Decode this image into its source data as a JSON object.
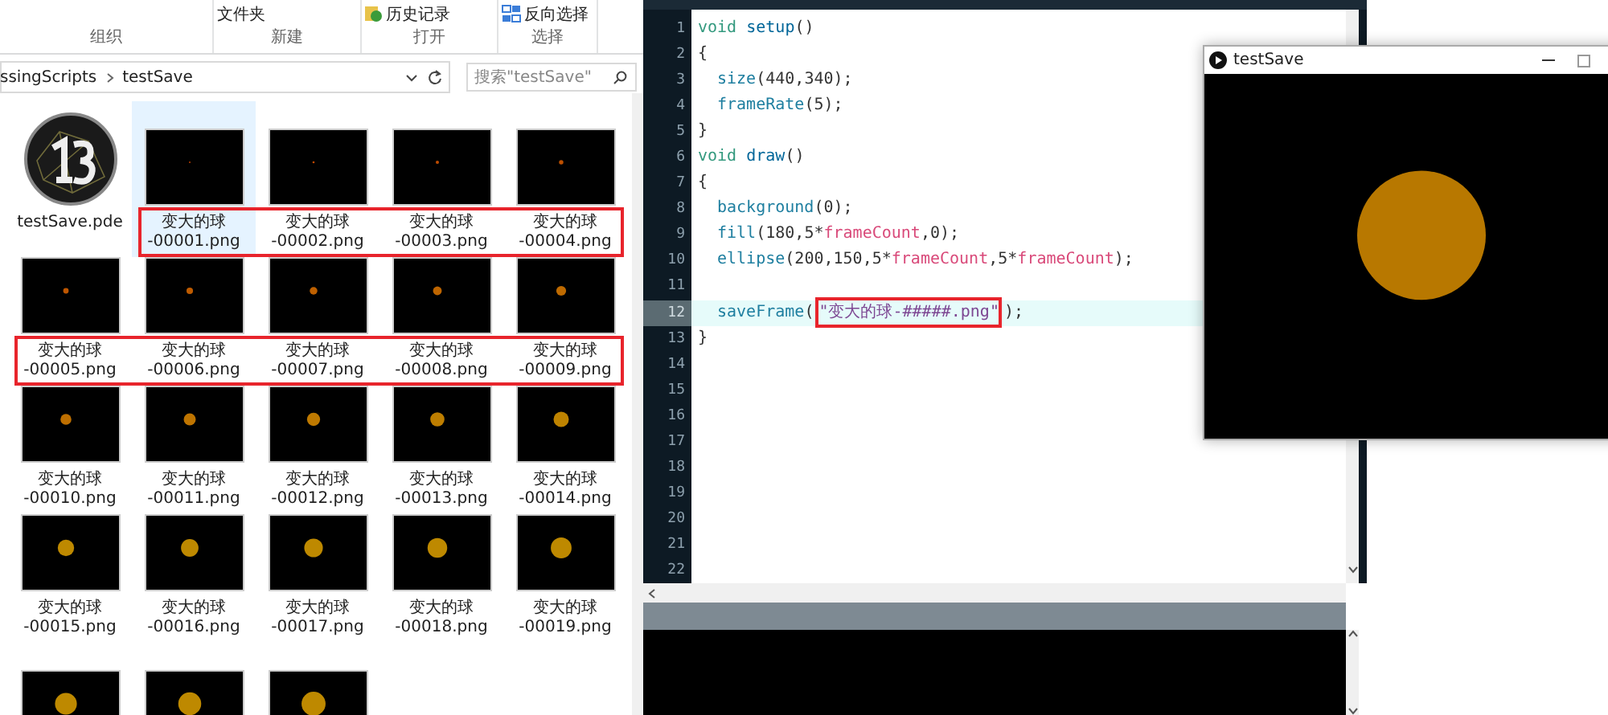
{
  "ribbon": {
    "groups": [
      {
        "label": "组织"
      },
      {
        "label": "新建",
        "items": [
          {
            "kind": "plain",
            "label": "文件夹"
          }
        ]
      },
      {
        "label": "打开",
        "items": [
          {
            "kind": "history",
            "label": "历史记录"
          }
        ]
      },
      {
        "label": "选择",
        "items": [
          {
            "kind": "select",
            "label": "反向选择"
          }
        ]
      }
    ]
  },
  "address_bar": {
    "path": [
      "ssingScripts",
      "testSave"
    ]
  },
  "search": {
    "placeholder": "搜索\"testSave\""
  },
  "files": {
    "rows": [
      {
        "items": [
          {
            "kind": "pde",
            "name_lines": [
              "testSave.pde"
            ],
            "selected": false,
            "marked": false
          },
          {
            "kind": "png",
            "name_lines": [
              "变大的球",
              "-00001.png"
            ],
            "selected": true,
            "marked": true
          },
          {
            "kind": "png",
            "name_lines": [
              "变大的球",
              "-00002.png"
            ],
            "selected": false,
            "marked": true
          },
          {
            "kind": "png",
            "name_lines": [
              "变大的球",
              "-00003.png"
            ],
            "selected": false,
            "marked": true
          },
          {
            "kind": "png",
            "name_lines": [
              "变大的球",
              "-00004.png"
            ],
            "selected": false,
            "marked": true
          }
        ]
      },
      {
        "items": [
          {
            "kind": "png",
            "name_lines": [
              "变大的球",
              "-00005.png"
            ],
            "selected": false,
            "marked": true
          },
          {
            "kind": "png",
            "name_lines": [
              "变大的球",
              "-00006.png"
            ],
            "selected": false,
            "marked": true
          },
          {
            "kind": "png",
            "name_lines": [
              "变大的球",
              "-00007.png"
            ],
            "selected": false,
            "marked": true
          },
          {
            "kind": "png",
            "name_lines": [
              "变大的球",
              "-00008.png"
            ],
            "selected": false,
            "marked": true
          },
          {
            "kind": "png",
            "name_lines": [
              "变大的球",
              "-00009.png"
            ],
            "selected": false,
            "marked": true
          }
        ]
      },
      {
        "items": [
          {
            "kind": "png",
            "name_lines": [
              "变大的球",
              "-00010.png"
            ],
            "selected": false,
            "marked": false
          },
          {
            "kind": "png",
            "name_lines": [
              "变大的球",
              "-00011.png"
            ],
            "selected": false,
            "marked": false
          },
          {
            "kind": "png",
            "name_lines": [
              "变大的球",
              "-00012.png"
            ],
            "selected": false,
            "marked": false
          },
          {
            "kind": "png",
            "name_lines": [
              "变大的球",
              "-00013.png"
            ],
            "selected": false,
            "marked": false
          },
          {
            "kind": "png",
            "name_lines": [
              "变大的球",
              "-00014.png"
            ],
            "selected": false,
            "marked": false
          }
        ]
      },
      {
        "items": [
          {
            "kind": "png",
            "name_lines": [
              "变大的球",
              "-00015.png"
            ],
            "selected": false,
            "marked": false
          },
          {
            "kind": "png",
            "name_lines": [
              "变大的球",
              "-00016.png"
            ],
            "selected": false,
            "marked": false
          },
          {
            "kind": "png",
            "name_lines": [
              "变大的球",
              "-00017.png"
            ],
            "selected": false,
            "marked": false
          },
          {
            "kind": "png",
            "name_lines": [
              "变大的球",
              "-00018.png"
            ],
            "selected": false,
            "marked": false
          },
          {
            "kind": "png",
            "name_lines": [
              "变大的球",
              "-00019.png"
            ],
            "selected": false,
            "marked": false
          }
        ]
      },
      {
        "items": [
          {
            "kind": "png",
            "selected": false,
            "marked": false
          },
          {
            "kind": "png",
            "selected": false,
            "marked": false
          },
          {
            "kind": "png",
            "selected": false,
            "marked": false
          }
        ]
      }
    ]
  },
  "editor": {
    "lines": [
      {
        "number": "1",
        "highlighted": false,
        "indented": false,
        "tokens": [
          {
            "kind": "keyword",
            "text": "void "
          },
          {
            "kind": "function",
            "text": "setup"
          },
          {
            "kind": "plain",
            "text": "()"
          }
        ]
      },
      {
        "number": "2",
        "highlighted": false,
        "indented": false,
        "tokens": [
          {
            "kind": "plain",
            "text": "{"
          }
        ]
      },
      {
        "number": "3",
        "highlighted": false,
        "indented": true,
        "tokens": [
          {
            "kind": "builtin",
            "text": "size"
          },
          {
            "kind": "plain",
            "text": "(440,340);"
          }
        ]
      },
      {
        "number": "4",
        "highlighted": false,
        "indented": true,
        "tokens": [
          {
            "kind": "builtin",
            "text": "frameRate"
          },
          {
            "kind": "plain",
            "text": "(5);"
          }
        ]
      },
      {
        "number": "5",
        "highlighted": false,
        "indented": false,
        "tokens": [
          {
            "kind": "plain",
            "text": "}"
          }
        ]
      },
      {
        "number": "6",
        "highlighted": false,
        "indented": false,
        "tokens": [
          {
            "kind": "keyword",
            "text": "void "
          },
          {
            "kind": "function",
            "text": "draw"
          },
          {
            "kind": "plain",
            "text": "()"
          }
        ]
      },
      {
        "number": "7",
        "highlighted": false,
        "indented": false,
        "tokens": [
          {
            "kind": "plain",
            "text": "{"
          }
        ]
      },
      {
        "number": "8",
        "highlighted": false,
        "indented": true,
        "tokens": [
          {
            "kind": "builtin",
            "text": "background"
          },
          {
            "kind": "plain",
            "text": "(0);"
          }
        ]
      },
      {
        "number": "9",
        "highlighted": false,
        "indented": true,
        "tokens": [
          {
            "kind": "builtin",
            "text": "fill"
          },
          {
            "kind": "plain",
            "text": "(180,5*"
          },
          {
            "kind": "variable",
            "text": "frameCount"
          },
          {
            "kind": "plain",
            "text": ",0);"
          }
        ]
      },
      {
        "number": "10",
        "highlighted": false,
        "indented": true,
        "tokens": [
          {
            "kind": "builtin",
            "text": "ellipse"
          },
          {
            "kind": "plain",
            "text": "(200,150,5*"
          },
          {
            "kind": "variable",
            "text": "frameCount"
          },
          {
            "kind": "plain",
            "text": ",5*"
          },
          {
            "kind": "variable",
            "text": "frameCount"
          },
          {
            "kind": "plain",
            "text": ");"
          }
        ]
      },
      {
        "number": "11",
        "highlighted": false
      },
      {
        "number": "12",
        "highlighted": true,
        "indented": true,
        "tokens": [
          {
            "kind": "builtin",
            "text": "saveFrame"
          },
          {
            "kind": "plain",
            "text": "("
          },
          {
            "kind": "string",
            "text": "\"变大的球-#####.png\"",
            "marked": true
          },
          {
            "kind": "plain",
            "text": ");"
          }
        ]
      },
      {
        "number": "13",
        "highlighted": false,
        "indented": false,
        "tokens": [
          {
            "kind": "plain",
            "text": "}"
          }
        ]
      },
      {
        "number": "14",
        "highlighted": false
      },
      {
        "number": "15",
        "highlighted": false
      },
      {
        "number": "16",
        "highlighted": false
      },
      {
        "number": "17",
        "highlighted": false
      },
      {
        "number": "18",
        "highlighted": false
      },
      {
        "number": "19",
        "highlighted": false
      },
      {
        "number": "20",
        "highlighted": false
      },
      {
        "number": "21",
        "highlighted": false
      },
      {
        "number": "22",
        "highlighted": false
      }
    ]
  },
  "sketch_window": {
    "title": "testSave"
  }
}
